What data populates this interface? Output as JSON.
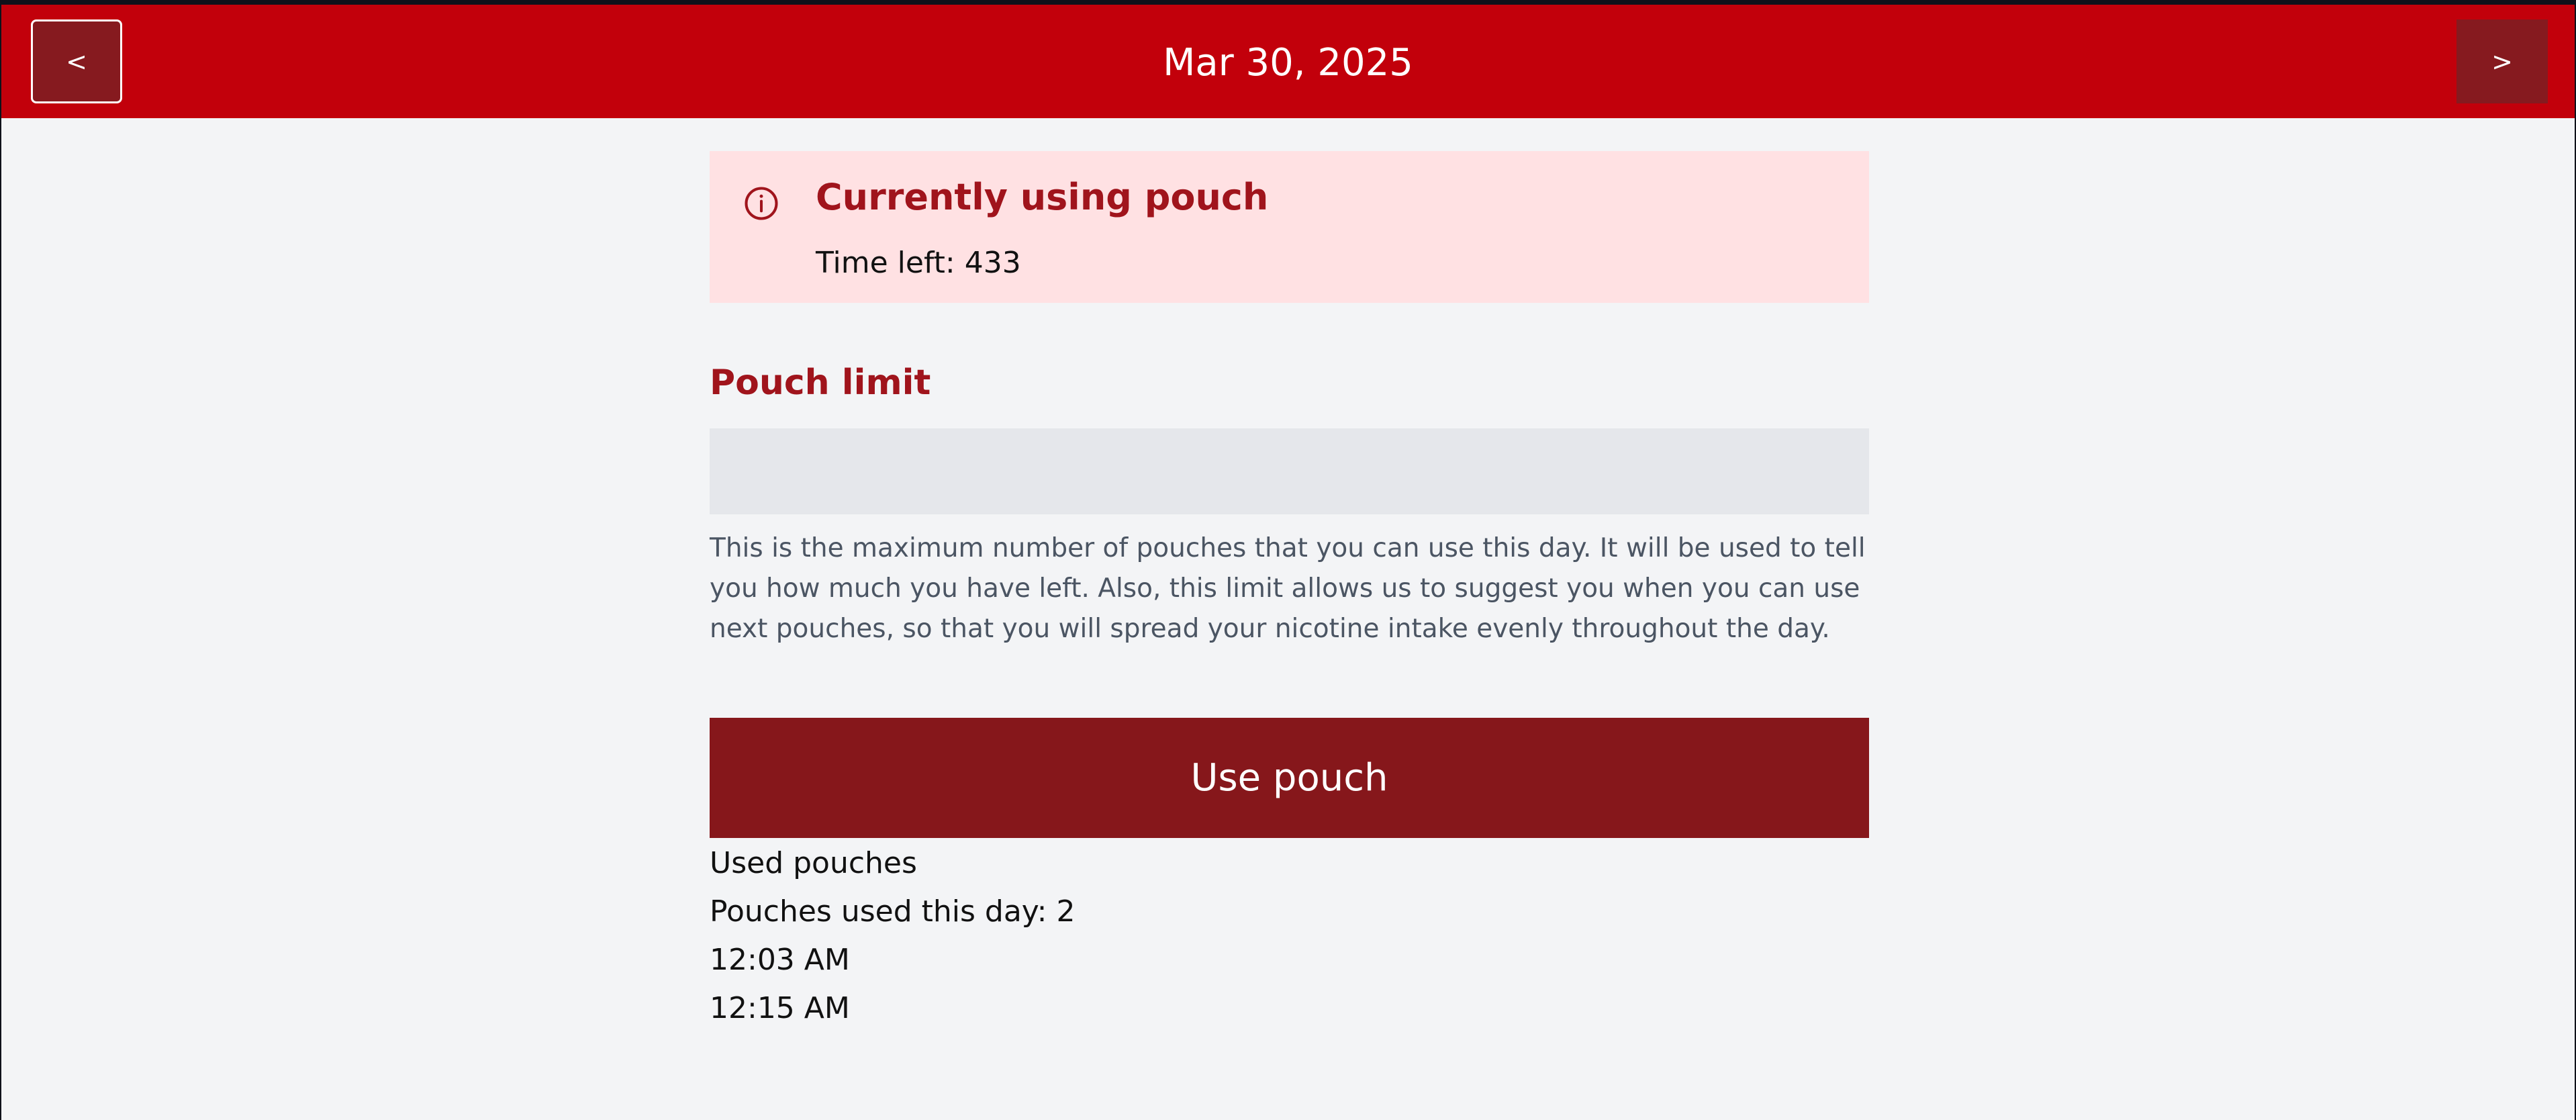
{
  "header": {
    "prev_label": "<",
    "date": "Mar 30, 2025",
    "next_label": ">"
  },
  "status": {
    "title": "Currently using pouch",
    "time_left": "Time left: 433",
    "icon": "info-icon"
  },
  "limit": {
    "label": "Pouch limit",
    "value": "",
    "placeholder": "",
    "helper": "This is the maximum number of pouches that you can use this day. It will be used to tell you how much you have left. Also, this limit allows us to suggest you when you can use next pouches, so that you will spread your nicotine intake evenly throughout the day."
  },
  "actions": {
    "use_pouch": "Use pouch"
  },
  "used": {
    "title": "Used pouches",
    "count_text": "Pouches used this day: 2",
    "times": [
      "12:03 AM",
      "12:15 AM"
    ]
  },
  "colors": {
    "topbar": "#c2000b",
    "nav_button": "#861a1f",
    "alert_background": "#ffe1e3",
    "accent_text": "#a0141c",
    "primary_button": "#86171b",
    "page_background": "#f3f4f6"
  }
}
